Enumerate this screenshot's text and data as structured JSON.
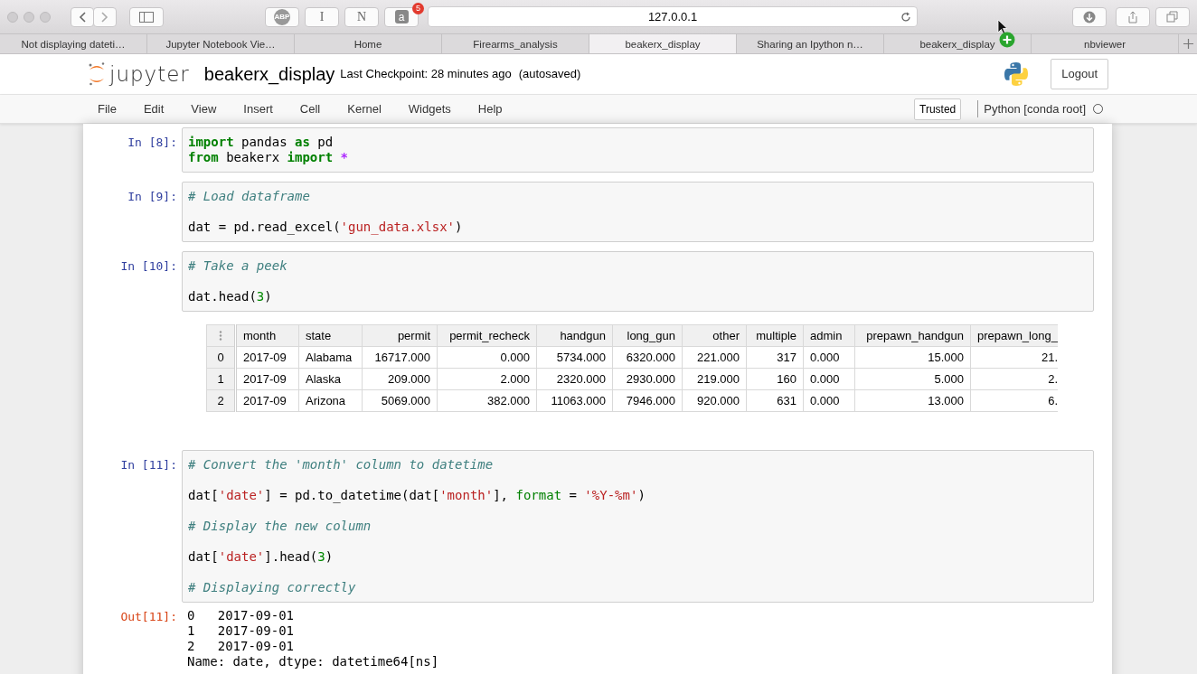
{
  "browser": {
    "address": "127.0.0.1",
    "badge_count": "5",
    "buttons": [
      {
        "kind": "abp",
        "label": "ABP"
      },
      {
        "kind": "text",
        "label": "I"
      },
      {
        "kind": "text",
        "label": "N"
      },
      {
        "kind": "amazon",
        "label": "a"
      }
    ],
    "tabs": [
      {
        "label": "Not displaying dateti…",
        "selected": false
      },
      {
        "label": "Jupyter Notebook Vie…",
        "selected": false
      },
      {
        "label": "Home",
        "selected": false
      },
      {
        "label": "Firearms_analysis",
        "selected": false
      },
      {
        "label": "beakerx_display",
        "selected": true
      },
      {
        "label": "Sharing an Ipython n…",
        "selected": false
      },
      {
        "label": "beakerx_display",
        "selected": false
      },
      {
        "label": "nbviewer",
        "selected": false
      }
    ]
  },
  "header": {
    "logo_text": "jupyter",
    "notebook_name": "beakerx_display",
    "checkpoint": "Last Checkpoint: 28 minutes ago",
    "save_status": "(autosaved)",
    "logout": "Logout"
  },
  "menu": {
    "items": [
      "File",
      "Edit",
      "View",
      "Insert",
      "Cell",
      "Kernel",
      "Widgets",
      "Help"
    ],
    "trusted": "Trusted",
    "kernel_name": "Python [conda root]",
    "kernel_busy": false
  },
  "cells": [
    {
      "prompt": "In [8]:",
      "blocks": [
        [
          [
            {
              "kind": "keyword",
              "text": "import"
            },
            {
              "kind": "plain",
              "text": " pandas "
            },
            {
              "kind": "keyword",
              "text": "as"
            },
            {
              "kind": "plain",
              "text": " pd"
            }
          ],
          [
            {
              "kind": "keyword",
              "text": "from"
            },
            {
              "kind": "plain",
              "text": " beakerx "
            },
            {
              "kind": "keyword",
              "text": "import"
            },
            {
              "kind": "operator",
              "text": " *"
            }
          ]
        ]
      ]
    },
    {
      "prompt": "In [9]:",
      "blocks": [
        [
          [
            {
              "kind": "comment",
              "text": "# Load dataframe"
            }
          ]
        ],
        [
          [
            {
              "kind": "plain",
              "text": "dat = pd.read_excel("
            },
            {
              "kind": "string",
              "text": "'gun_data.xlsx'"
            },
            {
              "kind": "plain",
              "text": ")"
            }
          ]
        ]
      ]
    },
    {
      "prompt": "In [10]:",
      "blocks": [
        [
          [
            {
              "kind": "comment",
              "text": "# Take a peek"
            }
          ]
        ],
        [
          [
            {
              "kind": "plain",
              "text": "dat.head("
            },
            {
              "kind": "number",
              "text": "3"
            },
            {
              "kind": "plain",
              "text": ")"
            }
          ]
        ]
      ],
      "table": {
        "columns": [
          {
            "label": "month",
            "kind": "text"
          },
          {
            "label": "state",
            "kind": "text"
          },
          {
            "label": "permit",
            "kind": "number"
          },
          {
            "label": "permit_recheck",
            "kind": "number"
          },
          {
            "label": "handgun",
            "kind": "number"
          },
          {
            "label": "long_gun",
            "kind": "number"
          },
          {
            "label": "other",
            "kind": "number"
          },
          {
            "label": "multiple",
            "kind": "number"
          },
          {
            "label": "admin",
            "kind": "text"
          },
          {
            "label": "prepawn_handgun",
            "kind": "number"
          },
          {
            "label": "prepawn_long_",
            "kind": "number"
          }
        ],
        "rows": [
          {
            "index": "0",
            "cells": [
              "2017-09",
              "Alabama",
              "16717.000",
              "0.000",
              "5734.000",
              "6320.000",
              "221.000",
              "317",
              "0.000",
              "15.000",
              "21."
            ]
          },
          {
            "index": "1",
            "cells": [
              "2017-09",
              "Alaska",
              "209.000",
              "2.000",
              "2320.000",
              "2930.000",
              "219.000",
              "160",
              "0.000",
              "5.000",
              "2."
            ]
          },
          {
            "index": "2",
            "cells": [
              "2017-09",
              "Arizona",
              "5069.000",
              "382.000",
              "11063.000",
              "7946.000",
              "920.000",
              "631",
              "0.000",
              "13.000",
              "6."
            ]
          }
        ]
      }
    },
    {
      "prompt": "In [11]:",
      "blocks": [
        [
          [
            {
              "kind": "comment",
              "text": "# Convert the 'month' column to datetime"
            }
          ]
        ],
        [
          [
            {
              "kind": "plain",
              "text": "dat["
            },
            {
              "kind": "string",
              "text": "'date'"
            },
            {
              "kind": "plain",
              "text": "] = pd.to_datetime(dat["
            },
            {
              "kind": "string",
              "text": "'month'"
            },
            {
              "kind": "plain",
              "text": "], "
            },
            {
              "kind": "argument",
              "text": "format"
            },
            {
              "kind": "plain",
              "text": " = "
            },
            {
              "kind": "string",
              "text": "'%Y-%m'"
            },
            {
              "kind": "plain",
              "text": ")"
            }
          ]
        ],
        [
          [
            {
              "kind": "comment",
              "text": "# Display the new column"
            }
          ]
        ],
        [
          [
            {
              "kind": "plain",
              "text": "dat["
            },
            {
              "kind": "string",
              "text": "'date'"
            },
            {
              "kind": "plain",
              "text": "].head("
            },
            {
              "kind": "number",
              "text": "3"
            },
            {
              "kind": "plain",
              "text": ")"
            }
          ]
        ],
        [
          [
            {
              "kind": "comment",
              "text": "# Displaying correctly"
            }
          ]
        ]
      ],
      "output": {
        "prompt": "Out[11]:",
        "lines": [
          "0   2017-09-01",
          "1   2017-09-01",
          "2   2017-09-01",
          "Name: date, dtype: datetime64[ns]"
        ]
      }
    }
  ]
}
